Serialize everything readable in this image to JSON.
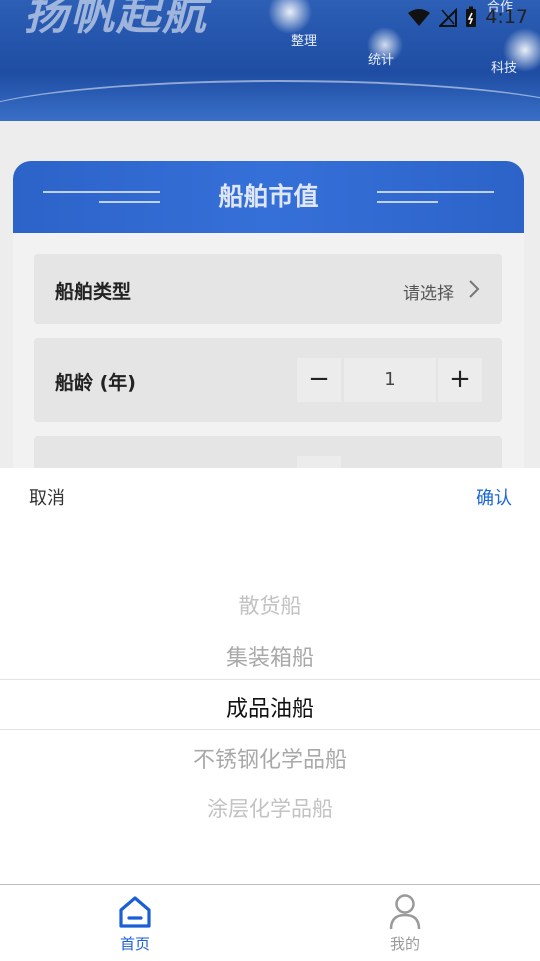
{
  "banner": {
    "title": "扬帆起航",
    "labels": [
      "整理",
      "统计",
      "科技",
      "合作"
    ]
  },
  "status_bar": {
    "time": "4:17"
  },
  "card": {
    "title": "船舶市值",
    "ship_type": {
      "label": "船舶类型",
      "value": "请选择"
    },
    "ship_age": {
      "label": "船龄 (年)",
      "value": "1",
      "minus": "−",
      "plus": "+"
    }
  },
  "picker": {
    "cancel": "取消",
    "confirm": "确认",
    "options": [
      "散货船",
      "集装箱船",
      "成品油船",
      "不锈钢化学品船",
      "涂层化学品船"
    ],
    "selected": "成品油船"
  },
  "tabbar": {
    "tabs": [
      {
        "label": "首页",
        "icon": "home-icon",
        "active": true
      },
      {
        "label": "我的",
        "icon": "user-icon",
        "active": false
      }
    ],
    "active_color": "#1a5fd6",
    "inactive_color": "#9a9a9a"
  }
}
